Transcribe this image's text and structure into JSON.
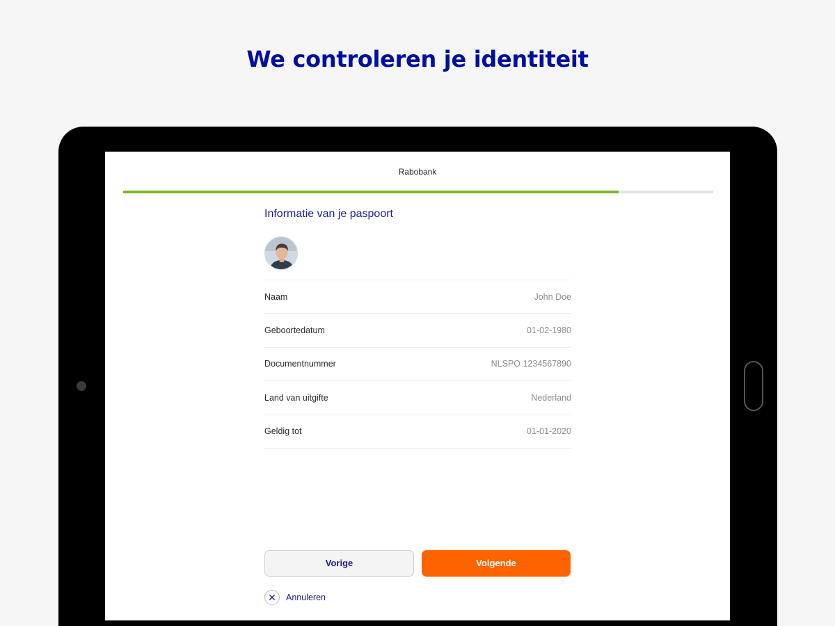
{
  "headline": "We controleren je identiteit",
  "app": {
    "title": "Rabobank",
    "progress": 0.84
  },
  "passport": {
    "section_title": "Informatie van je paspoort",
    "rows": [
      {
        "label": "Naam",
        "value": "John Doe"
      },
      {
        "label": "Geboortedatum",
        "value": "01-02-1980"
      },
      {
        "label": "Documentnummer",
        "value": "NLSPO 1234567890"
      },
      {
        "label": "Land van uitgifte",
        "value": "Nederland"
      },
      {
        "label": "Geldig tot",
        "value": "01-01-2020"
      }
    ]
  },
  "actions": {
    "previous_label": "Vorige",
    "next_label": "Volgende",
    "cancel_label": "Annuleren",
    "cancel_icon": "close-icon"
  },
  "colors": {
    "headline": "#000f9f",
    "progress": "#7ab929",
    "primary_button": "#fd6400",
    "link": "#1b1b9a"
  }
}
